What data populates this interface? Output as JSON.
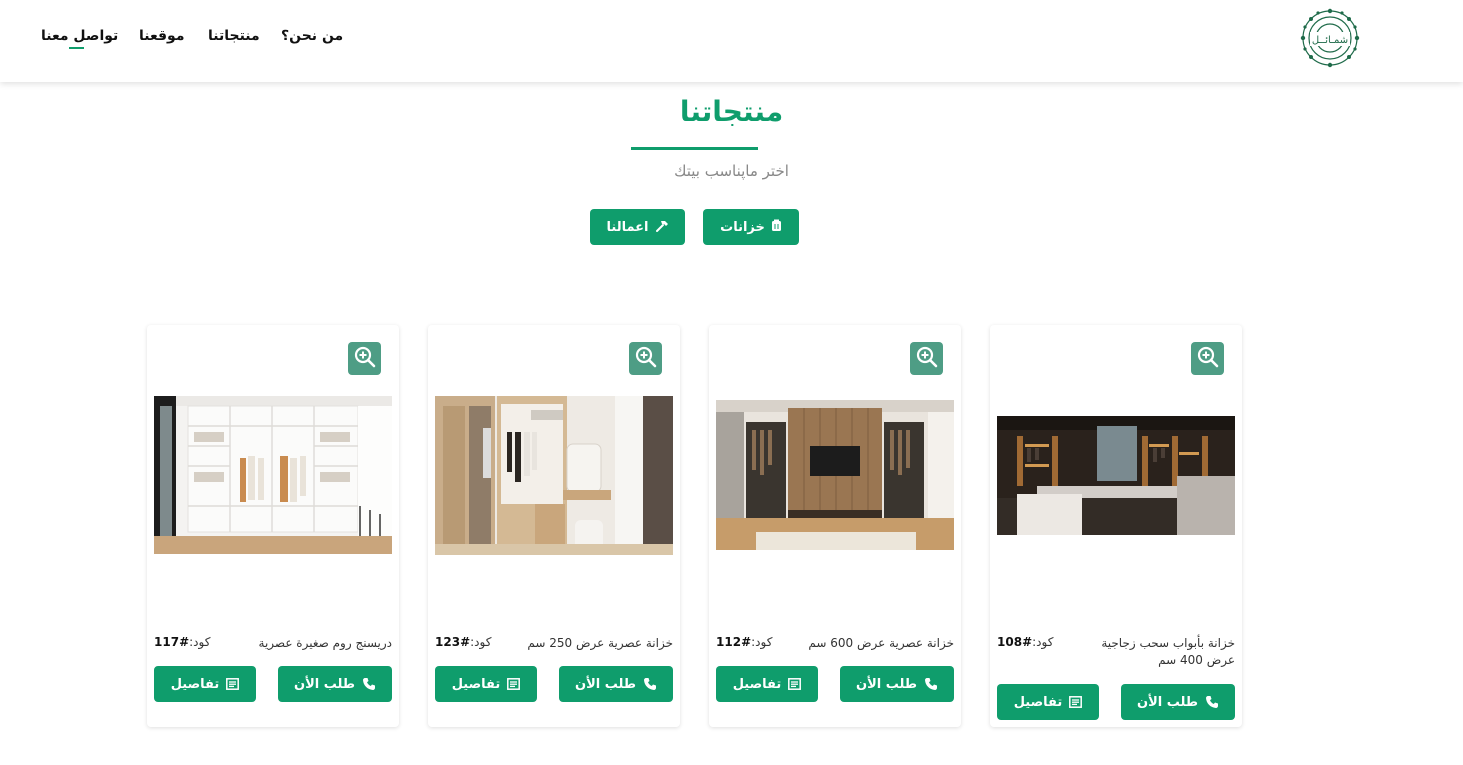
{
  "nav": {
    "items": [
      "من نحن؟",
      "منتجاتنا",
      "موقعنا",
      "تواصل معنا"
    ],
    "logo_text": "شمـائــل"
  },
  "section": {
    "title": "منتجاتنا",
    "subtitle": "اختر ماپناسب بيتك"
  },
  "filters": {
    "closets_label": "خزانات",
    "works_label": "اعمالنا"
  },
  "products": [
    {
      "name": "خزانة بأبواب سحب زجاجية عرض 400 سم",
      "code_label": "كود:",
      "code": "#108",
      "order_label": "طلب الأن",
      "details_label": "تفاصيل"
    },
    {
      "name": "خزانة عصرية عرض 600 سم",
      "code_label": "كود:",
      "code": "#112",
      "order_label": "طلب الأن",
      "details_label": "تفاصيل"
    },
    {
      "name": "خزانة عصرية عرض 250 سم",
      "code_label": "كود:",
      "code": "#123",
      "order_label": "طلب الأن",
      "details_label": "تفاصيل"
    },
    {
      "name": "دريسنج روم صغيرة عصرية",
      "code_label": "كود:",
      "code": "#117",
      "order_label": "طلب الأن",
      "details_label": "تفاصيل"
    }
  ],
  "colors": {
    "accent": "#0f9d6c",
    "zoom_bg": "#4e9d85"
  }
}
